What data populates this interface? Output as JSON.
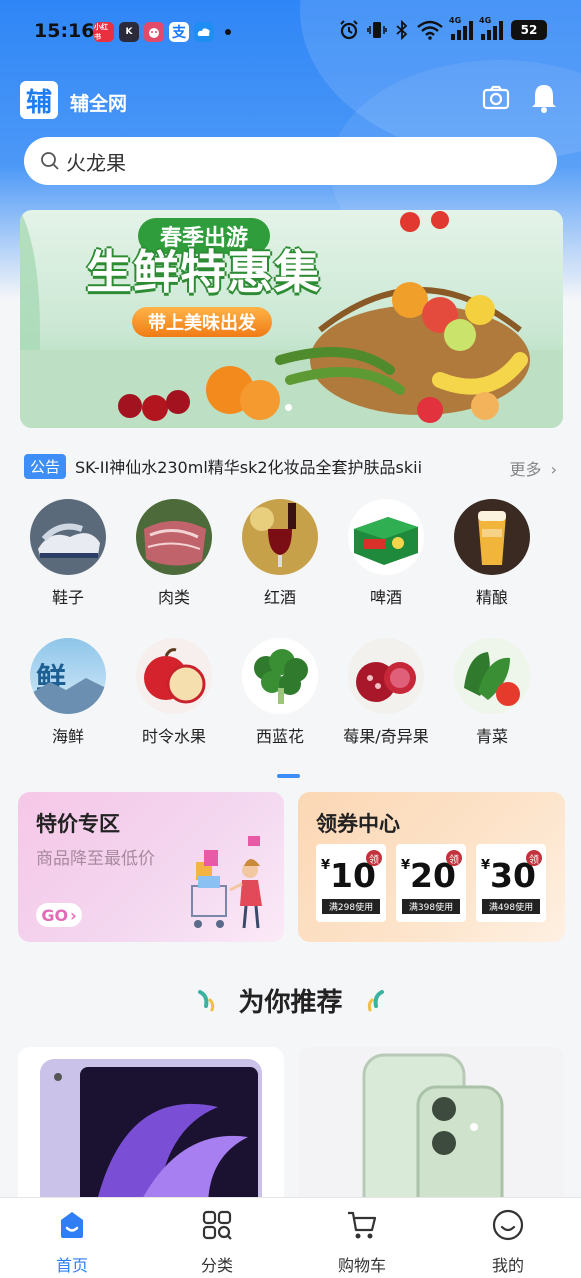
{
  "status_bar": {
    "time": "15:16",
    "apps": [
      {
        "icon": "xiaohongshu-icon",
        "text": "小红书",
        "color": "#e8303f"
      },
      {
        "icon": "k-app-icon",
        "text": "K",
        "color": "#2a2a3a"
      },
      {
        "icon": "game-app-icon",
        "text": "",
        "color": "#e24a6a"
      },
      {
        "icon": "alipay-icon",
        "text": "支",
        "color": "#1677ff"
      },
      {
        "icon": "cloud-app-icon",
        "text": "",
        "color": "#1f8ef2"
      }
    ],
    "signal_tags": [
      "4G",
      "4G"
    ],
    "battery": "52"
  },
  "header": {
    "logo_text": "辅",
    "app_name": "辅全网"
  },
  "search": {
    "value": "火龙果"
  },
  "banner": {
    "subtitle": "春季出游",
    "title": "生鲜特惠集",
    "slogan": "带上美味出发"
  },
  "notice": {
    "badge": "公告",
    "text": "SK-II神仙水230ml精华sk2化妆品全套护肤品skii",
    "more": "更多"
  },
  "categories": [
    {
      "label": "鞋子",
      "icon": "shoes-icon"
    },
    {
      "label": "肉类",
      "icon": "meat-icon"
    },
    {
      "label": "红酒",
      "icon": "red-wine-icon"
    },
    {
      "label": "啤酒",
      "icon": "beer-icon"
    },
    {
      "label": "精酿",
      "icon": "craft-beer-icon"
    },
    {
      "label": "海鲜",
      "icon": "seafood-icon",
      "overlay": "鲜"
    },
    {
      "label": "时令水果",
      "icon": "apple-icon"
    },
    {
      "label": "西蓝花",
      "icon": "broccoli-icon"
    },
    {
      "label": "莓果/奇异果",
      "icon": "berries-icon"
    },
    {
      "label": "青菜",
      "icon": "greens-icon"
    }
  ],
  "promo_special": {
    "title": "特价专区",
    "subtitle": "商品降至最低价",
    "go": "GO"
  },
  "promo_coupons": {
    "title": "领券中心",
    "currency": "¥",
    "tag": "领",
    "coupons": [
      {
        "amount": "10",
        "condition": "满298使用"
      },
      {
        "amount": "20",
        "condition": "满398使用"
      },
      {
        "amount": "30",
        "condition": "满498使用"
      }
    ]
  },
  "recommend": {
    "title": "为你推荐"
  },
  "tabs": [
    {
      "label": "首页",
      "icon": "home-icon",
      "active": true
    },
    {
      "label": "分类",
      "icon": "category-grid-icon",
      "active": false
    },
    {
      "label": "购物车",
      "icon": "cart-icon",
      "active": false
    },
    {
      "label": "我的",
      "icon": "profile-smile-icon",
      "active": false
    }
  ],
  "colors": {
    "brand": "#2f86f6",
    "tab_active": "#2f7ef5",
    "coupon_tag": "#c4323d"
  }
}
